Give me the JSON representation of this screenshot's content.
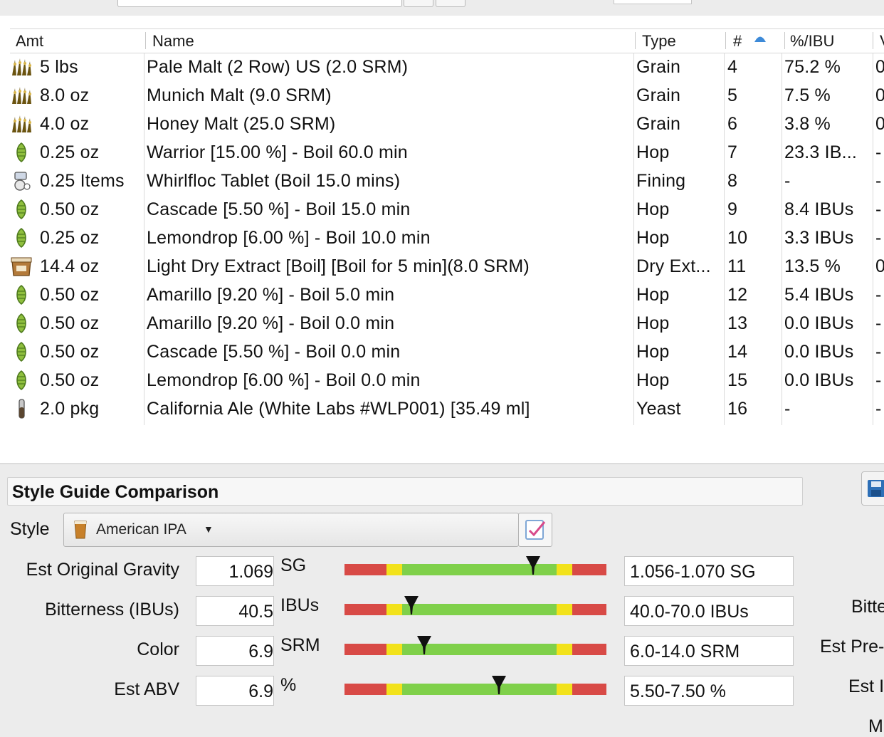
{
  "table": {
    "headers": [
      "Amt",
      "Name",
      "Type",
      "#",
      "%/IBU",
      "V"
    ],
    "rows": [
      {
        "icon": "grain-icon",
        "amt": "5 lbs",
        "name": "Pale Malt (2 Row) US (2.0 SRM)",
        "type": "Grain",
        "num": "4",
        "pct": "75.2 %",
        "extra": "0"
      },
      {
        "icon": "grain-icon",
        "amt": "8.0 oz",
        "name": "Munich Malt (9.0 SRM)",
        "type": "Grain",
        "num": "5",
        "pct": "7.5 %",
        "extra": "0"
      },
      {
        "icon": "grain-icon",
        "amt": "4.0 oz",
        "name": "Honey Malt (25.0 SRM)",
        "type": "Grain",
        "num": "6",
        "pct": "3.8 %",
        "extra": "0"
      },
      {
        "icon": "hop-icon",
        "amt": "0.25 oz",
        "name": "Warrior [15.00 %] - Boil 60.0 min",
        "type": "Hop",
        "num": "7",
        "pct": "23.3 IB...",
        "extra": "-"
      },
      {
        "icon": "fining-icon",
        "amt": "0.25 Items",
        "name": "Whirlfloc Tablet (Boil 15.0 mins)",
        "type": "Fining",
        "num": "8",
        "pct": "-",
        "extra": "-"
      },
      {
        "icon": "hop-icon",
        "amt": "0.50 oz",
        "name": "Cascade [5.50 %] - Boil 15.0 min",
        "type": "Hop",
        "num": "9",
        "pct": "8.4 IBUs",
        "extra": "-"
      },
      {
        "icon": "hop-icon",
        "amt": "0.25 oz",
        "name": "Lemondrop [6.00 %] - Boil 10.0 min",
        "type": "Hop",
        "num": "10",
        "pct": "3.3 IBUs",
        "extra": "-"
      },
      {
        "icon": "extract-icon",
        "amt": "14.4 oz",
        "name": "Light Dry Extract [Boil] [Boil for 5 min](8.0 SRM)",
        "type": "Dry Ext...",
        "num": "11",
        "pct": "13.5 %",
        "extra": "0"
      },
      {
        "icon": "hop-icon",
        "amt": "0.50 oz",
        "name": "Amarillo [9.20 %] - Boil 5.0 min",
        "type": "Hop",
        "num": "12",
        "pct": "5.4 IBUs",
        "extra": "-"
      },
      {
        "icon": "hop-icon",
        "amt": "0.50 oz",
        "name": "Amarillo [9.20 %] - Boil 0.0 min",
        "type": "Hop",
        "num": "13",
        "pct": "0.0 IBUs",
        "extra": "-"
      },
      {
        "icon": "hop-icon",
        "amt": "0.50 oz",
        "name": "Cascade [5.50 %] - Boil 0.0 min",
        "type": "Hop",
        "num": "14",
        "pct": "0.0 IBUs",
        "extra": "-"
      },
      {
        "icon": "hop-icon",
        "amt": "0.50 oz",
        "name": "Lemondrop [6.00 %] - Boil 0.0 min",
        "type": "Hop",
        "num": "15",
        "pct": "0.0 IBUs",
        "extra": "-"
      },
      {
        "icon": "yeast-icon",
        "amt": "2.0 pkg",
        "name": "California Ale (White Labs #WLP001) [35.49 ml]",
        "type": "Yeast",
        "num": "16",
        "pct": "-",
        "extra": "-"
      }
    ]
  },
  "style_guide": {
    "title": "Style Guide Comparison",
    "style_label": "Style",
    "style_value": "American IPA",
    "stats": [
      {
        "label": "Est Original Gravity",
        "value": "1.069",
        "unit": "SG",
        "range": "1.056-1.070 SG",
        "marker_pos": 0.72,
        "in_range_start": 0.22,
        "in_range_end": 0.81
      },
      {
        "label": "Bitterness (IBUs)",
        "value": "40.5",
        "unit": "IBUs",
        "range": "40.0-70.0 IBUs",
        "marker_pos": 0.255,
        "in_range_start": 0.22,
        "in_range_end": 0.81
      },
      {
        "label": "Color",
        "value": "6.9",
        "unit": "SRM",
        "range": "6.0-14.0 SRM",
        "marker_pos": 0.305,
        "in_range_start": 0.22,
        "in_range_end": 0.81
      },
      {
        "label": "Est ABV",
        "value": "6.9",
        "unit": "%",
        "range": "5.50-7.50 %",
        "marker_pos": 0.59,
        "in_range_start": 0.22,
        "in_range_end": 0.81
      }
    ],
    "right_labels": [
      "Bitte",
      "Est Pre-",
      "Est I",
      "M"
    ]
  },
  "colors": {
    "bar_red": "#d84a46",
    "bar_yellow": "#f2e21b",
    "bar_green": "#7fd04a",
    "marker": "#111111"
  }
}
